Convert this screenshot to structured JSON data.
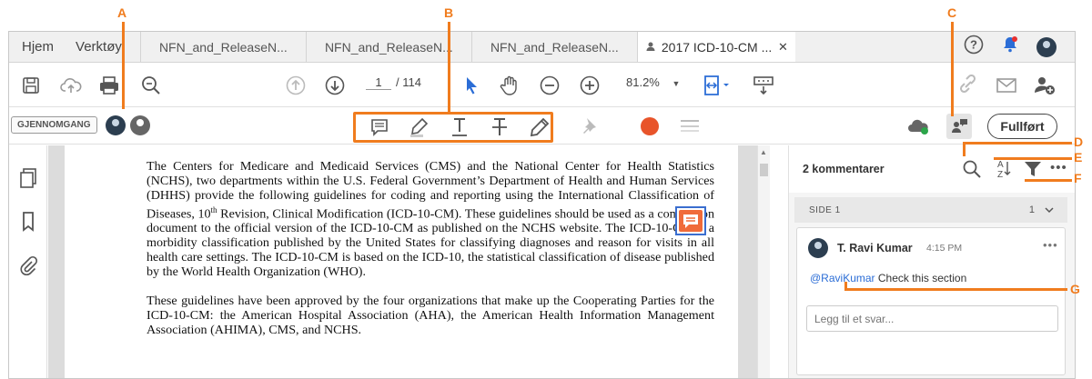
{
  "tabs": {
    "home": "Hjem",
    "tools": "Verktøy",
    "docs": [
      "NFN_and_ReleaseN...",
      "NFN_and_ReleaseN...",
      "NFN_and_ReleaseN..."
    ],
    "active_doc": "2017 ICD-10-CM ...",
    "close": "✕"
  },
  "toolbar": {
    "page_current": "1",
    "page_total": "/  114",
    "zoom": "81.2%"
  },
  "review": {
    "badge": "GJENNOMGANG",
    "done_label": "Fullført"
  },
  "document": {
    "paragraph1_before": "The Centers for Medicare and Medicaid Services (CMS) and the National Center for Health Statistics (NCHS), two departments within the U.S. Federal Government’s Department of Health and Human Services (DHHS) provide the following guidelines for coding and reporting using the International Classification of Diseases, 10",
    "paragraph1_sup": "th",
    "paragraph1_after": " Revision, Clinical Modification (ICD-10-CM). These guidelines should be used as a companion document to the official version of the ICD-10-CM as published on the NCHS website. The ICD-10-CM is a morbidity classification published by the United States for classifying diagnoses and reason for visits in all health care settings.  The ICD-10-CM is based on the ICD-10, the statistical classification of disease published by the World Health Organization (WHO).",
    "paragraph2": "These guidelines have been approved by the four organizations that make up the Cooperating Parties for the ICD-10-CM: the American Hospital Association (AHA), the American Health Information Management Association (AHIMA), CMS, and NCHS."
  },
  "comments_panel": {
    "count_label": "2 kommentarer",
    "page_label": "SIDE 1",
    "page_count": "1",
    "comment": {
      "author": "T. Ravi Kumar",
      "time": "4:15 PM",
      "mention": "@RaviKumar",
      "text": " Check this section"
    },
    "reply_placeholder": "Legg til et svar..."
  },
  "callouts": [
    "A",
    "B",
    "C",
    "D",
    "E",
    "F",
    "G"
  ],
  "colors": {
    "accent": "#f07c1e",
    "record": "#e8542a",
    "notification": "#2b6dd6",
    "sticky_note": "#f06b3a",
    "mention": "#2b6dd6"
  }
}
